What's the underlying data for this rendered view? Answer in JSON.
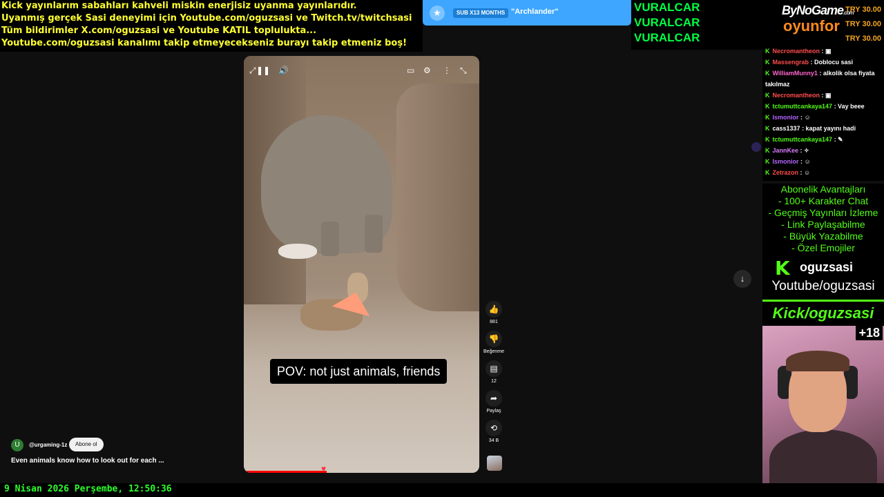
{
  "overlay": {
    "lines": [
      "Kick yayınlarım sabahları kahveli miskin enerjisiz uyanma yayınlarıdır.",
      "Uyanmış gerçek Sasi deneyimi için Youtube.com/oguzsasi ve Twitch.tv/twitchsasi",
      "Tüm bildirimler X.com/oguzsasi ve Youtube KATIL toplulukta...",
      "Youtube.com/oguzsasi kanalımı takip etmeyecekseniz burayı takip etmeniz boş!"
    ],
    "sub_alert": {
      "tag": "SUB X13 MONTHS",
      "name": "\"Archlander\""
    },
    "vuralcar": [
      "VURALCAR",
      "VURALCAR",
      "VURALCAR"
    ],
    "sponsor": {
      "logo_top": "ByNoGame",
      "logo_top_suffix": ".com",
      "logo_bottom": "oyunfor",
      "prices": [
        "TRY 30.00",
        "TRY 30.00",
        "TRY 30.00"
      ]
    },
    "clock": "9 Nisan 2026 Perşembe, 12:50:36"
  },
  "chat": {
    "messages": [
      {
        "user": "Necromantheon",
        "color": "#ff4d4d",
        "text": ": ▣"
      },
      {
        "user": "Massengrab",
        "color": "#ff4d4d",
        "text": ": Doblocu sasi"
      },
      {
        "user": "WilliamMunny1",
        "color": "#ff66cc",
        "text": ": alkolik olsa fiyata takılmaz"
      },
      {
        "user": "Necromantheon",
        "color": "#ff4d4d",
        "text": ": ▣"
      },
      {
        "user": "tctumuttcankaya147",
        "color": "#53fc18",
        "text": ": Vay beee"
      },
      {
        "user": "Ismonior",
        "color": "#b266ff",
        "text": ": ☺"
      },
      {
        "user": "cass1337",
        "color": "#ffffff",
        "text": ": kapat yayını hadi"
      },
      {
        "user": "tctumuttcankaya147",
        "color": "#53fc18",
        "text": ": ✎"
      },
      {
        "user": "JannKee",
        "color": "#d97cff",
        "text": ": ✧"
      },
      {
        "user": "Ismonior",
        "color": "#b266ff",
        "text": ": ☺"
      },
      {
        "user": "Zetrazon",
        "color": "#ff4d4d",
        "text": ": ☺"
      }
    ]
  },
  "perks": {
    "title": "Abonelik Avantajları",
    "items": [
      "- 100+ Karakter Chat",
      "- Geçmiş Yayınları İzleme",
      "- Link Paylaşabilme",
      "- Büyük Yazabilme",
      "- Özel Emojiler"
    ]
  },
  "brand": {
    "kick_name": "oguzsasi",
    "youtube": "Youtube/oguzsasi",
    "kick": "Kick/oguzsasi",
    "age": "+18"
  },
  "short": {
    "caption": "POV: not just animals, friends",
    "likes": "881",
    "dislike_label": "Beğenme",
    "comments": "12",
    "share_label": "Paylaş",
    "remix": "34 B",
    "progress": 0.34,
    "channel_avatar": "U",
    "channel": "@urgaming-1z",
    "subscribe": "Abone ol",
    "description": "Even animals know how to look out for each ..."
  },
  "colors": {
    "kick_green": "#53fc18",
    "accent_blue": "#3ea6ff",
    "overlay_yellow": "#ffff33"
  }
}
